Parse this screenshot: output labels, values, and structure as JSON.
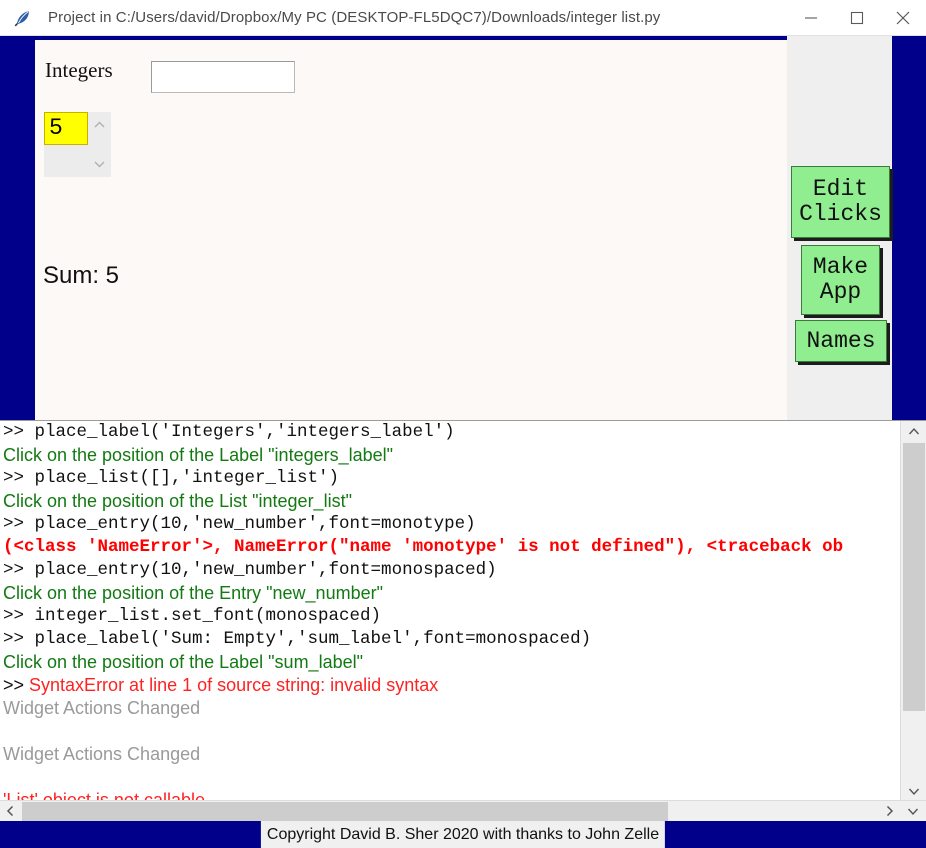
{
  "window": {
    "title": "Project in C:/Users/david/Dropbox/My PC (DESKTOP-FL5DQC7)/Downloads/integer list.py",
    "icon": "feather-quill-icon",
    "controls": {
      "minimize_label": "—",
      "maximize_label": "□",
      "close_label": "✕"
    }
  },
  "colors": {
    "navy_frame": "#00008B",
    "canvas": "#FDF9F7",
    "gray_panel": "#EFEFEF",
    "button_green": "#90EE90",
    "selection_yellow": "#FFFF00",
    "console_green": "#137A13",
    "console_red": "#FF0000",
    "console_gray": "#9A9A9A"
  },
  "app_canvas": {
    "integers_label": "Integers",
    "new_number_entry": {
      "value": "",
      "placeholder": ""
    },
    "integer_list": {
      "items": [
        "5"
      ],
      "selected": "5"
    },
    "sum_label": "Sum: 5"
  },
  "tool_buttons": [
    {
      "label": "Edit\nClicks",
      "line1": "Edit",
      "line2": "Clicks",
      "name": "edit-clicks-button"
    },
    {
      "label": "Make\nApp",
      "line1": "Make",
      "line2": "App",
      "name": "make-app-button"
    },
    {
      "label": "Names",
      "line1": "Names",
      "line2": "",
      "name": "names-button"
    }
  ],
  "console": {
    "lines": [
      {
        "kind": "cmd",
        "text": ">> place_label('Integers','integers_label')"
      },
      {
        "kind": "click",
        "text": "Click on the position of the Label \"integers_label\""
      },
      {
        "kind": "cmd",
        "text": ">> place_list([],'integer_list')"
      },
      {
        "kind": "click",
        "text": "Click on the position of the List \"integer_list\""
      },
      {
        "kind": "cmd",
        "text": ">> place_entry(10,'new_number',font=monotype)"
      },
      {
        "kind": "err",
        "text": "(<class 'NameError'>, NameError(\"name 'monotype' is not defined\"), <traceback ob"
      },
      {
        "kind": "cmd",
        "text": ">> place_entry(10,'new_number',font=monospaced)"
      },
      {
        "kind": "click",
        "text": "Click on the position of the Entry \"new_number\""
      },
      {
        "kind": "cmd",
        "text": ">> integer_list.set_font(monospaced)"
      },
      {
        "kind": "cmd",
        "text": ">> place_label('Sum: Empty','sum_label',font=monospaced)"
      },
      {
        "kind": "click",
        "text": "Click on the position of the Label \"sum_label\""
      },
      {
        "kind": "syntax",
        "prompt": ">>",
        "text": "SyntaxError at line 1 of source string: invalid syntax"
      },
      {
        "kind": "info",
        "text": "Widget Actions Changed"
      },
      {
        "kind": "blank",
        "text": ""
      },
      {
        "kind": "info",
        "text": "Widget Actions Changed"
      },
      {
        "kind": "blank",
        "text": ""
      },
      {
        "kind": "errsans",
        "text": "'List' object is not callable"
      }
    ]
  },
  "status_bar": {
    "text": "Copyright David B. Sher 2020 with thanks to John Zelle"
  }
}
